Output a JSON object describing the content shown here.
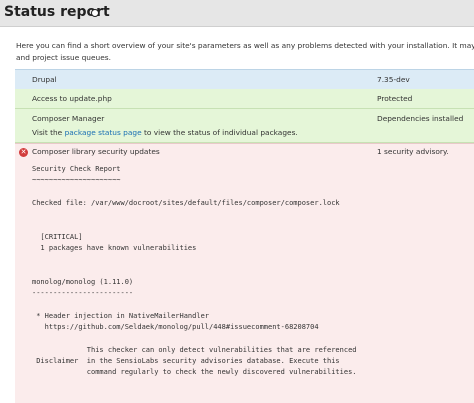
{
  "page": {
    "title": "Status report"
  },
  "intro": {
    "line1": "Here you can find a short overview of your site's parameters as well as any problems detected with your installation. It may be useful to c",
    "line2": "and project issue queues."
  },
  "rows": [
    {
      "label": "Drupal",
      "value": "7.35-dev"
    },
    {
      "label": "Access to update.php",
      "value": "Protected"
    },
    {
      "label": "Composer Manager",
      "value": "Dependencies installed",
      "description_prefix": "Visit the ",
      "description_link": "package status page",
      "description_suffix": " to view the status of individual packages."
    },
    {
      "label": "Composer library security updates",
      "value": "1 security advisory.",
      "report": "Security Check Report\n~~~~~~~~~~~~~~~~~~~~~\n\nChecked file: /var/www/docroot/sites/default/files/composer/composer.lock\n\n\n  [CRITICAL]\n  1 packages have known vulnerabilities\n\n\nmonolog/monolog (1.11.0)\n------------------------\n\n * Header injection in NativeMailerHandler\n   https://github.com/Seldaek/monolog/pull/448#issuecomment-68208704\n\n             This checker can only detect vulnerabilities that are referenced\n Disclaimer  in the SensioLabs security advisories database. Execute this\n             command regularly to check the newly discovered vulnerabilities."
    }
  ]
}
